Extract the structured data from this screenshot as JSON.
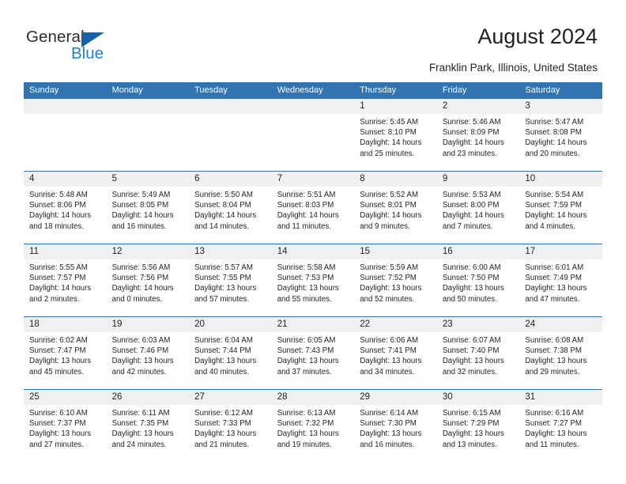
{
  "brand": {
    "name_part1": "General",
    "name_part2": "Blue",
    "color_dark": "#2e2e2e",
    "color_blue": "#1f7fd0",
    "triangle_color": "#1462ab"
  },
  "header": {
    "title": "August 2024",
    "subtitle": "Franklin Park, Illinois, United States",
    "accent_color": "#3273b1",
    "daynum_band_color": "#f0f0f0"
  },
  "weekdays": [
    "Sunday",
    "Monday",
    "Tuesday",
    "Wednesday",
    "Thursday",
    "Friday",
    "Saturday"
  ],
  "weeks": [
    [
      {
        "day": "",
        "sunrise": "",
        "sunset": "",
        "daylight1": "",
        "daylight2": ""
      },
      {
        "day": "",
        "sunrise": "",
        "sunset": "",
        "daylight1": "",
        "daylight2": ""
      },
      {
        "day": "",
        "sunrise": "",
        "sunset": "",
        "daylight1": "",
        "daylight2": ""
      },
      {
        "day": "",
        "sunrise": "",
        "sunset": "",
        "daylight1": "",
        "daylight2": ""
      },
      {
        "day": "1",
        "sunrise": "Sunrise: 5:45 AM",
        "sunset": "Sunset: 8:10 PM",
        "daylight1": "Daylight: 14 hours",
        "daylight2": "and 25 minutes."
      },
      {
        "day": "2",
        "sunrise": "Sunrise: 5:46 AM",
        "sunset": "Sunset: 8:09 PM",
        "daylight1": "Daylight: 14 hours",
        "daylight2": "and 23 minutes."
      },
      {
        "day": "3",
        "sunrise": "Sunrise: 5:47 AM",
        "sunset": "Sunset: 8:08 PM",
        "daylight1": "Daylight: 14 hours",
        "daylight2": "and 20 minutes."
      }
    ],
    [
      {
        "day": "4",
        "sunrise": "Sunrise: 5:48 AM",
        "sunset": "Sunset: 8:06 PM",
        "daylight1": "Daylight: 14 hours",
        "daylight2": "and 18 minutes."
      },
      {
        "day": "5",
        "sunrise": "Sunrise: 5:49 AM",
        "sunset": "Sunset: 8:05 PM",
        "daylight1": "Daylight: 14 hours",
        "daylight2": "and 16 minutes."
      },
      {
        "day": "6",
        "sunrise": "Sunrise: 5:50 AM",
        "sunset": "Sunset: 8:04 PM",
        "daylight1": "Daylight: 14 hours",
        "daylight2": "and 14 minutes."
      },
      {
        "day": "7",
        "sunrise": "Sunrise: 5:51 AM",
        "sunset": "Sunset: 8:03 PM",
        "daylight1": "Daylight: 14 hours",
        "daylight2": "and 11 minutes."
      },
      {
        "day": "8",
        "sunrise": "Sunrise: 5:52 AM",
        "sunset": "Sunset: 8:01 PM",
        "daylight1": "Daylight: 14 hours",
        "daylight2": "and 9 minutes."
      },
      {
        "day": "9",
        "sunrise": "Sunrise: 5:53 AM",
        "sunset": "Sunset: 8:00 PM",
        "daylight1": "Daylight: 14 hours",
        "daylight2": "and 7 minutes."
      },
      {
        "day": "10",
        "sunrise": "Sunrise: 5:54 AM",
        "sunset": "Sunset: 7:59 PM",
        "daylight1": "Daylight: 14 hours",
        "daylight2": "and 4 minutes."
      }
    ],
    [
      {
        "day": "11",
        "sunrise": "Sunrise: 5:55 AM",
        "sunset": "Sunset: 7:57 PM",
        "daylight1": "Daylight: 14 hours",
        "daylight2": "and 2 minutes."
      },
      {
        "day": "12",
        "sunrise": "Sunrise: 5:56 AM",
        "sunset": "Sunset: 7:56 PM",
        "daylight1": "Daylight: 14 hours",
        "daylight2": "and 0 minutes."
      },
      {
        "day": "13",
        "sunrise": "Sunrise: 5:57 AM",
        "sunset": "Sunset: 7:55 PM",
        "daylight1": "Daylight: 13 hours",
        "daylight2": "and 57 minutes."
      },
      {
        "day": "14",
        "sunrise": "Sunrise: 5:58 AM",
        "sunset": "Sunset: 7:53 PM",
        "daylight1": "Daylight: 13 hours",
        "daylight2": "and 55 minutes."
      },
      {
        "day": "15",
        "sunrise": "Sunrise: 5:59 AM",
        "sunset": "Sunset: 7:52 PM",
        "daylight1": "Daylight: 13 hours",
        "daylight2": "and 52 minutes."
      },
      {
        "day": "16",
        "sunrise": "Sunrise: 6:00 AM",
        "sunset": "Sunset: 7:50 PM",
        "daylight1": "Daylight: 13 hours",
        "daylight2": "and 50 minutes."
      },
      {
        "day": "17",
        "sunrise": "Sunrise: 6:01 AM",
        "sunset": "Sunset: 7:49 PM",
        "daylight1": "Daylight: 13 hours",
        "daylight2": "and 47 minutes."
      }
    ],
    [
      {
        "day": "18",
        "sunrise": "Sunrise: 6:02 AM",
        "sunset": "Sunset: 7:47 PM",
        "daylight1": "Daylight: 13 hours",
        "daylight2": "and 45 minutes."
      },
      {
        "day": "19",
        "sunrise": "Sunrise: 6:03 AM",
        "sunset": "Sunset: 7:46 PM",
        "daylight1": "Daylight: 13 hours",
        "daylight2": "and 42 minutes."
      },
      {
        "day": "20",
        "sunrise": "Sunrise: 6:04 AM",
        "sunset": "Sunset: 7:44 PM",
        "daylight1": "Daylight: 13 hours",
        "daylight2": "and 40 minutes."
      },
      {
        "day": "21",
        "sunrise": "Sunrise: 6:05 AM",
        "sunset": "Sunset: 7:43 PM",
        "daylight1": "Daylight: 13 hours",
        "daylight2": "and 37 minutes."
      },
      {
        "day": "22",
        "sunrise": "Sunrise: 6:06 AM",
        "sunset": "Sunset: 7:41 PM",
        "daylight1": "Daylight: 13 hours",
        "daylight2": "and 34 minutes."
      },
      {
        "day": "23",
        "sunrise": "Sunrise: 6:07 AM",
        "sunset": "Sunset: 7:40 PM",
        "daylight1": "Daylight: 13 hours",
        "daylight2": "and 32 minutes."
      },
      {
        "day": "24",
        "sunrise": "Sunrise: 6:08 AM",
        "sunset": "Sunset: 7:38 PM",
        "daylight1": "Daylight: 13 hours",
        "daylight2": "and 29 minutes."
      }
    ],
    [
      {
        "day": "25",
        "sunrise": "Sunrise: 6:10 AM",
        "sunset": "Sunset: 7:37 PM",
        "daylight1": "Daylight: 13 hours",
        "daylight2": "and 27 minutes."
      },
      {
        "day": "26",
        "sunrise": "Sunrise: 6:11 AM",
        "sunset": "Sunset: 7:35 PM",
        "daylight1": "Daylight: 13 hours",
        "daylight2": "and 24 minutes."
      },
      {
        "day": "27",
        "sunrise": "Sunrise: 6:12 AM",
        "sunset": "Sunset: 7:33 PM",
        "daylight1": "Daylight: 13 hours",
        "daylight2": "and 21 minutes."
      },
      {
        "day": "28",
        "sunrise": "Sunrise: 6:13 AM",
        "sunset": "Sunset: 7:32 PM",
        "daylight1": "Daylight: 13 hours",
        "daylight2": "and 19 minutes."
      },
      {
        "day": "29",
        "sunrise": "Sunrise: 6:14 AM",
        "sunset": "Sunset: 7:30 PM",
        "daylight1": "Daylight: 13 hours",
        "daylight2": "and 16 minutes."
      },
      {
        "day": "30",
        "sunrise": "Sunrise: 6:15 AM",
        "sunset": "Sunset: 7:29 PM",
        "daylight1": "Daylight: 13 hours",
        "daylight2": "and 13 minutes."
      },
      {
        "day": "31",
        "sunrise": "Sunrise: 6:16 AM",
        "sunset": "Sunset: 7:27 PM",
        "daylight1": "Daylight: 13 hours",
        "daylight2": "and 11 minutes."
      }
    ]
  ]
}
